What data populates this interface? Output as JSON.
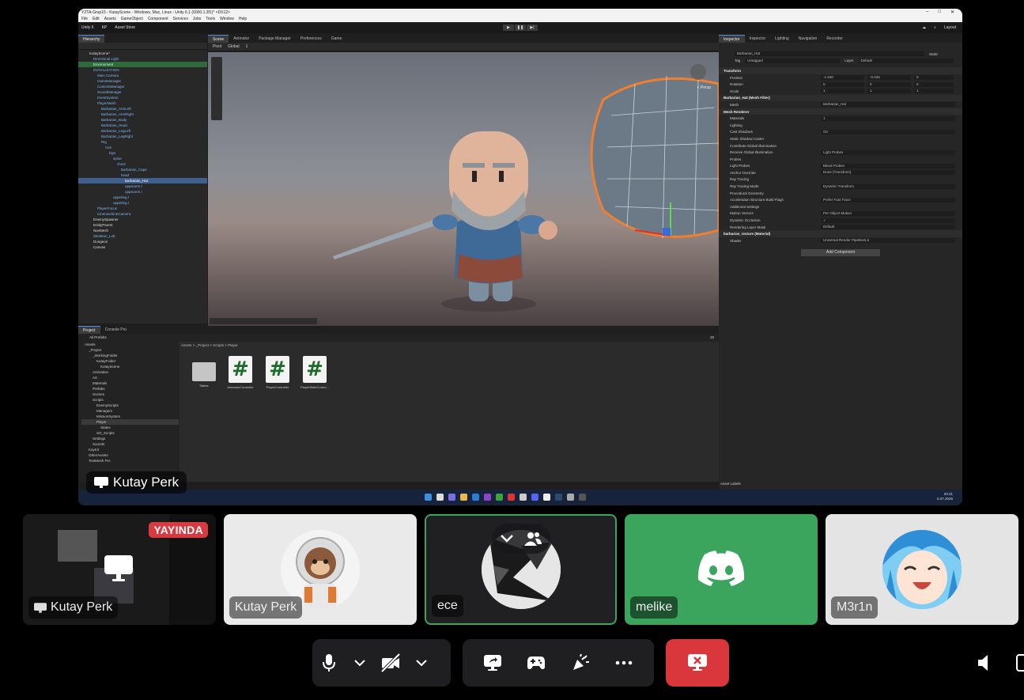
{
  "unity": {
    "window_title": "YZTA-Grup15 - KutayScene - Windows, Mac, Linux - Unity 6.1 (6000.1.3f1)* <DX12>",
    "menu": [
      "File",
      "Edit",
      "Assets",
      "GameObject",
      "Component",
      "Services",
      "Jobs",
      "Tools",
      "Window",
      "Help"
    ],
    "toolbar": {
      "unity_label": "Unity 6",
      "account": "KP",
      "asset_store": "Asset Store",
      "layout": "Layout"
    },
    "hierarchy": {
      "tabs": [
        "Hierarchy"
      ],
      "items": [
        "KutayScene*",
        "Directional Light",
        "Environment",
        "INITIALIZATION",
        "Main Camera",
        "GameManager",
        "ControlsManager",
        "SoundManager",
        "EventSystem",
        "PlayerMesh",
        "Barbarian_ArmLeft",
        "Barbarian_ArmRight",
        "Barbarian_Body",
        "Barbarian_Head",
        "Barbarian_LegLeft",
        "Barbarian_LegRight",
        "Rig",
        "root",
        "hips",
        "spine",
        "chest",
        "Barbarian_Cape",
        "head",
        "Barbarian_Hat",
        "upperarm.l",
        "upperarm.r",
        "upperleg.l",
        "upperleg.r",
        "PlayerFocus",
        "CinemachineCamera",
        "EnemySpawner",
        "EntityParent",
        "NavMesh",
        "Skeleton_Lott",
        "Dungeon",
        "Canvas"
      ]
    },
    "scene_tabs": [
      "Scene",
      "Animator",
      "Package Manager",
      "Preferences",
      "Game"
    ],
    "scene_toolbar": {
      "pivot": "Pivot",
      "global": "Global",
      "snap": "1"
    },
    "gizmo_label": "< Persp",
    "inspector": {
      "tabs": [
        "Inspector",
        "Inspector",
        "Lighting",
        "Navigation",
        "Recorder"
      ],
      "object_name": "Barbarian_Hat",
      "static_label": "Static",
      "tag": "Untagged",
      "layer": "Default",
      "transform": {
        "title": "Transform",
        "position": {
          "x": "-1.948",
          "y": "-0.026",
          "z": "0"
        },
        "rotation": {
          "x": "0",
          "y": "0",
          "z": "0"
        },
        "scale": {
          "x": "1",
          "y": "1",
          "z": "1"
        }
      },
      "rows": [
        {
          "k": "Barbarian_Hat (Mesh Filter)",
          "v": "",
          "h": true
        },
        {
          "k": "Mesh",
          "v": "Barbarian_Hat",
          "h": false
        },
        {
          "k": "Mesh Renderer",
          "v": "",
          "h": true
        },
        {
          "k": "Materials",
          "v": "1",
          "h": false
        },
        {
          "k": "Lighting",
          "v": "",
          "h": false
        },
        {
          "k": "Cast Shadows",
          "v": "On",
          "h": false
        },
        {
          "k": "Static Shadow Caster",
          "v": "",
          "h": false
        },
        {
          "k": "Contribute Global Illumination",
          "v": "",
          "h": false
        },
        {
          "k": "Receive Global Illumination",
          "v": "Light Probes",
          "h": false
        },
        {
          "k": "Probes",
          "v": "",
          "h": false
        },
        {
          "k": "Light Probes",
          "v": "Blend Probes",
          "h": false
        },
        {
          "k": "Anchor Override",
          "v": "None (Transform)",
          "h": false
        },
        {
          "k": "Ray Tracing",
          "v": "",
          "h": false
        },
        {
          "k": "Ray Tracing Mode",
          "v": "Dynamic Transform",
          "h": false
        },
        {
          "k": "Procedural Geometry",
          "v": "",
          "h": false
        },
        {
          "k": "Acceleration Structure Build Flags",
          "v": "Prefer Fast Trace",
          "h": false
        },
        {
          "k": "Additional Settings",
          "v": "",
          "h": false
        },
        {
          "k": "Motion Vectors",
          "v": "Per Object Motion",
          "h": false
        },
        {
          "k": "Dynamic Occlusion",
          "v": "✓",
          "h": false
        },
        {
          "k": "Rendering Layer Mask",
          "v": "Default",
          "h": false
        },
        {
          "k": "barbarian_texture (Material)",
          "v": "",
          "h": true
        },
        {
          "k": "Shader",
          "v": "Universal Render Pipeline/Lit",
          "h": false
        }
      ],
      "add_component": "Add Component",
      "asset_labels": "Asset Labels"
    },
    "project": {
      "tabs": [
        "Project",
        "Console Pro"
      ],
      "search_label": "All Prefabs",
      "breadcrumb": "Assets > _Project > Scripts > Player",
      "tree": [
        "Assets",
        "_Project",
        "_WorkingFolder",
        "KutayFolder",
        "KutayScene",
        "Animation",
        "Art",
        "Materials",
        "Prefabs",
        "Scenes",
        "Scripts",
        "EnemyScripts",
        "Managers",
        "MissionSystem",
        "Player",
        "States",
        "SO_Scripts",
        "Settings",
        "Sounds",
        "KayKit",
        "OtherAssets",
        "TextMesh Pro"
      ],
      "assets": [
        {
          "name": "States",
          "kind": "folder"
        },
        {
          "name": "AnimatorController",
          "kind": "cs"
        },
        {
          "name": "PlayerController",
          "kind": "cs"
        },
        {
          "name": "PlayerStateContro...",
          "kind": "cs"
        }
      ],
      "cs_glyph": "#",
      "badge": "28"
    },
    "taskbar": {
      "time": "20:21",
      "date": "5.07.2025"
    }
  },
  "stream_label": "Kutay Perk",
  "tiles": [
    {
      "name": "Kutay Perk",
      "badge": "YAYINDA"
    },
    {
      "name": "Kutay Perk"
    },
    {
      "name": "ece"
    },
    {
      "name": "melike"
    },
    {
      "name": "M3r1n"
    }
  ],
  "colors": {
    "live": "#d83a42",
    "melike_bg": "#3ba55d",
    "hangup": "#da373c",
    "speaking_border": "#3ba55d"
  },
  "icons": [
    "microphone-icon",
    "video-off-icon",
    "screen-share-icon",
    "gamepad-icon",
    "soundboard-icon",
    "more-icon",
    "hangup-icon",
    "volume-icon",
    "monitor-icon"
  ]
}
